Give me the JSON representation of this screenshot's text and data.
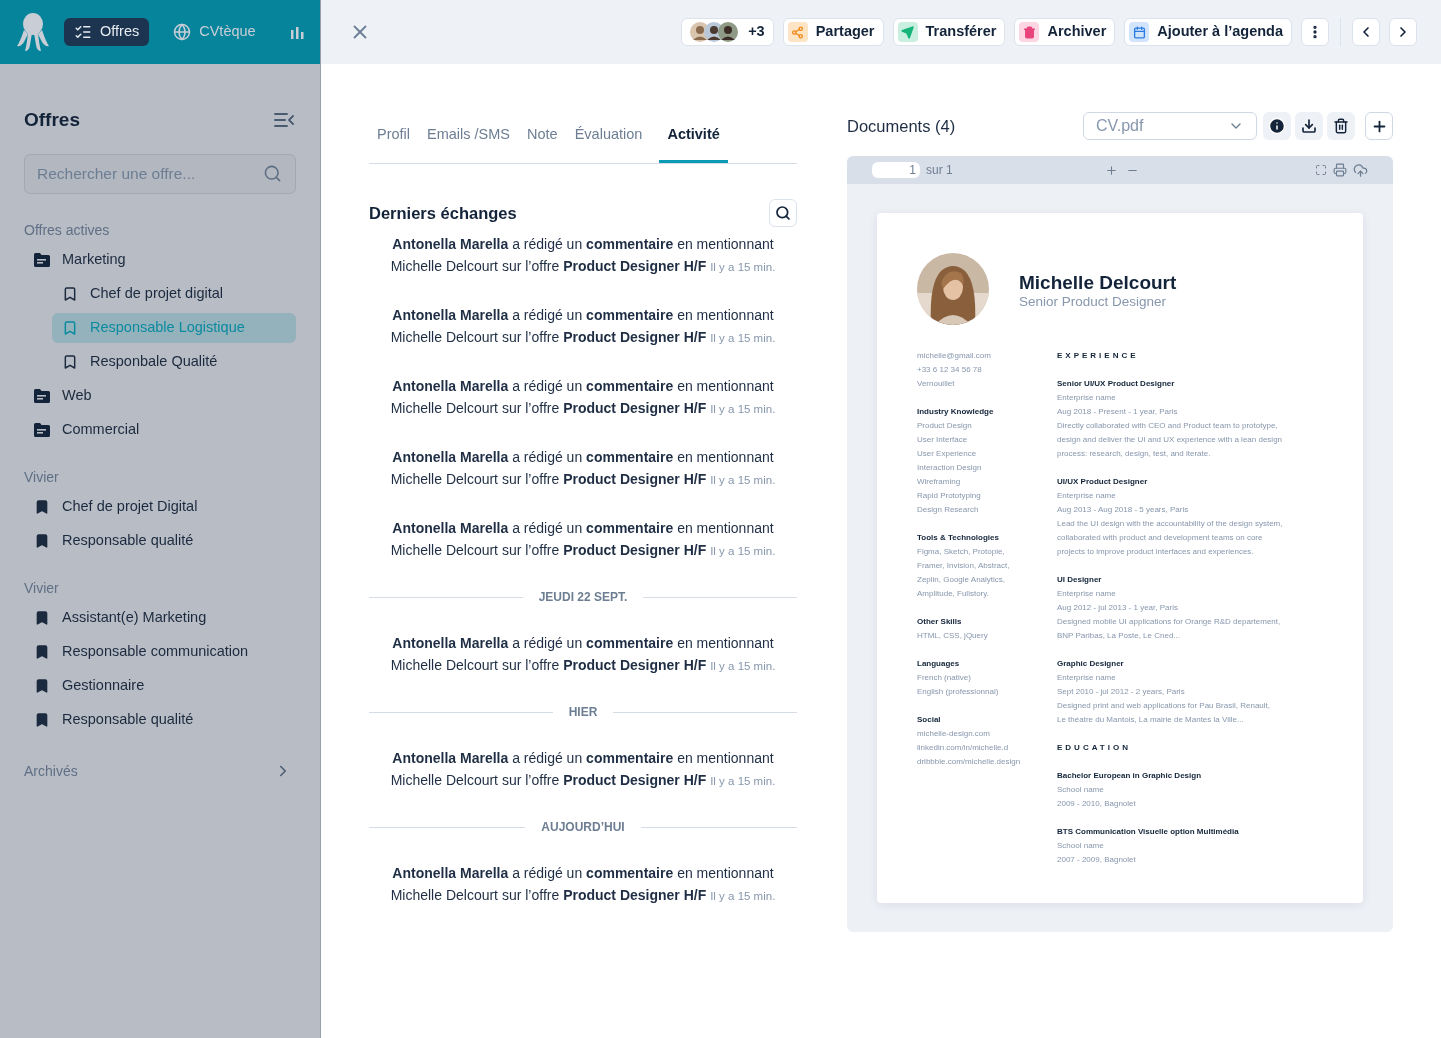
{
  "app_header": {
    "nav": [
      {
        "label": "Offres",
        "kind": "offers",
        "selected": true
      },
      {
        "label": "CVtèque",
        "kind": "cv",
        "selected": false
      },
      {
        "kind": "stats",
        "selected": false
      }
    ]
  },
  "sidebar": {
    "title": "Offres",
    "search": {
      "placeholder": "Rechercher une offre..."
    },
    "sections": [
      {
        "label": "Offres actives",
        "items": [
          {
            "label": "Marketing",
            "kind": "folder",
            "selected": false,
            "children": [
              {
                "label": "Chef de projet digital",
                "kind": "offer",
                "selected": false
              },
              {
                "label": "Responsable Logistique",
                "kind": "offer",
                "selected": true
              },
              {
                "label": "Responbale Qualité",
                "kind": "offer",
                "selected": false
              }
            ]
          },
          {
            "label": "Web",
            "kind": "folder",
            "selected": false
          },
          {
            "label": "Commercial",
            "kind": "folder",
            "selected": false
          }
        ]
      },
      {
        "label": "Vivier",
        "items": [
          {
            "label": "Chef de projet Digital",
            "kind": "pool",
            "selected": false
          },
          {
            "label": "Responsable qualité",
            "kind": "pool",
            "selected": false
          }
        ]
      },
      {
        "label": "Vivier",
        "items": [
          {
            "label": "Assistant(e) Marketing",
            "kind": "pool",
            "selected": false
          },
          {
            "label": "Responsable communication",
            "kind": "pool",
            "selected": false
          },
          {
            "label": "Gestionnaire",
            "kind": "pool",
            "selected": false
          },
          {
            "label": "Responsable qualité",
            "kind": "pool",
            "selected": false
          }
        ]
      }
    ],
    "archived": {
      "label": "Archivés"
    }
  },
  "toolbar": {
    "buttons": [
      {
        "kind": "avatars",
        "label": "+3"
      },
      {
        "kind": "share",
        "label": "Partager"
      },
      {
        "kind": "transfer",
        "label": "Transférer"
      },
      {
        "kind": "archive",
        "label": "Archiver"
      },
      {
        "kind": "calendar",
        "label": "Ajouter à l’agenda"
      }
    ]
  },
  "tabs": [
    {
      "label": "Profil",
      "selected": false
    },
    {
      "label": "Emails /SMS",
      "selected": false
    },
    {
      "label": "Note",
      "selected": false
    },
    {
      "label": "Évaluation",
      "selected": false
    },
    {
      "label": "Activité",
      "selected": true
    }
  ],
  "activity": {
    "title": "Derniers échanges",
    "items": [
      {
        "kind": "message",
        "text": "**Antonella Marella** a rédigé un **commentaire** en mentionnant Michelle Delcourt sur l’offre **Product Designer H/F**",
        "time": "Il y a 15 min."
      },
      {
        "kind": "message",
        "text": "**Antonella Marella** a rédigé un **commentaire** en mentionnant Michelle Delcourt sur l’offre **Product Designer H/F**",
        "time": "Il y a 15 min."
      },
      {
        "kind": "message",
        "text": "**Antonella Marella** a rédigé un **commentaire** en mentionnant Michelle Delcourt sur l’offre **Product Designer H/F**",
        "time": "Il y a 15 min."
      },
      {
        "kind": "message",
        "text": "**Antonella Marella** a rédigé un **commentaire** en mentionnant Michelle Delcourt sur l’offre **Product Designer H/F**",
        "time": "Il y a 15 min."
      },
      {
        "kind": "message",
        "text": "**Antonella Marella** a rédigé un **commentaire** en mentionnant Michelle Delcourt sur l’offre **Product Designer H/F**",
        "time": "Il y a 15 min."
      },
      {
        "kind": "separator",
        "label": "JEUDI 22 SEPT."
      },
      {
        "kind": "message",
        "text": "**Antonella Marella** a rédigé un **commentaire** en mentionnant Michelle Delcourt sur l’offre **Product Designer H/F**",
        "time": "Il y a 15 min."
      },
      {
        "kind": "separator",
        "label": "HIER"
      },
      {
        "kind": "message",
        "text": "**Antonella Marella** a rédigé un **commentaire** en mentionnant Michelle Delcourt sur l’offre **Product Designer H/F**",
        "time": "Il y a 15 min."
      },
      {
        "kind": "separator",
        "label": "AUJOURD’HUI"
      },
      {
        "kind": "message",
        "text": "**Antonella Marella** a rédigé un **commentaire** en mentionnant Michelle Delcourt sur l’offre **Product Designer H/F**",
        "time": "Il y a 15 min."
      }
    ]
  },
  "documents": {
    "title": "Documents (4)",
    "file": "CV.pdf",
    "viewer": {
      "page": "1",
      "of": "sur 1"
    },
    "cv": {
      "name": "Michelle Delcourt",
      "title": "Senior Product Designer",
      "contacts": [
        "michelle@gmail.com",
        "+33 6 12 34 56 78",
        "Vernouillet"
      ],
      "left_sections": [
        {
          "heading": "Industry Knowledge",
          "lines": [
            "Product Design",
            "User Interface",
            "User Experience",
            "Interaction Design",
            "Wireframing",
            "Rapid Prototyping",
            "Design Research"
          ]
        },
        {
          "heading": "Tools & Technologies",
          "lines": [
            "Figma, Sketch, Protopie,",
            "Framer, Invision, Abstract,",
            "Zeplin, Google Analytics,",
            "Amplitude, Fullstory."
          ]
        },
        {
          "heading": "Other Skills",
          "lines": [
            "HTML, CSS, jQuery"
          ]
        },
        {
          "heading": "Languages",
          "lines": [
            "French (native)",
            "English (professionnal)"
          ]
        },
        {
          "heading": "Social",
          "lines": [
            "michelle-design.com",
            "linkedin.com/in/michelle.d",
            "dribbble.com/michelle.design"
          ]
        }
      ],
      "experience_heading": "EXPERIENCE",
      "experience": [
        {
          "role": "Senior UI/UX Product Designer",
          "company": "Enterprise name",
          "dates": "Aug 2018 - Present - 1 year, Paris",
          "description": [
            "Directly collaborated with CEO and Product team to prototype,",
            "design and deliver the UI and UX experience with a lean design",
            "process: research, design, test, and iterate."
          ]
        },
        {
          "role": "UI/UX Product Designer",
          "company": "Enterprise name",
          "dates": "Aug 2013 - Aug 2018 - 5 years, Paris",
          "description": [
            "Lead the UI design with the accountability of the design system,",
            "collaborated with product and development teams on core",
            "projects to improve product interfaces and experiences."
          ]
        },
        {
          "role": "UI Designer",
          "company": "Enterprise name",
          "dates": "Aug 2012 - jul 2013 - 1 year, Paris",
          "description": [
            "Designed mobile UI applications for Orange R&D departement,",
            "BNP Paribas, La Poste, Le Cned..."
          ]
        },
        {
          "role": "Graphic Designer",
          "company": "Enterprise name",
          "dates": "Sept 2010 - jul 2012 - 2 years, Paris",
          "description": [
            "Designed print and web applications for Pau Brasil, Renault,",
            "Le théatre du Mantois, La mairie de Mantes la Ville..."
          ]
        }
      ],
      "education_heading": "EDUCATION",
      "education": [
        {
          "degree": "Bachelor European in Graphic Design",
          "school": "School name",
          "dates": "2009 - 2010, Bagnolet"
        },
        {
          "degree": "BTS Communication Visuelle option Multimédia",
          "school": "School name",
          "dates": "2007 - 2009, Bagnolet"
        }
      ]
    }
  }
}
